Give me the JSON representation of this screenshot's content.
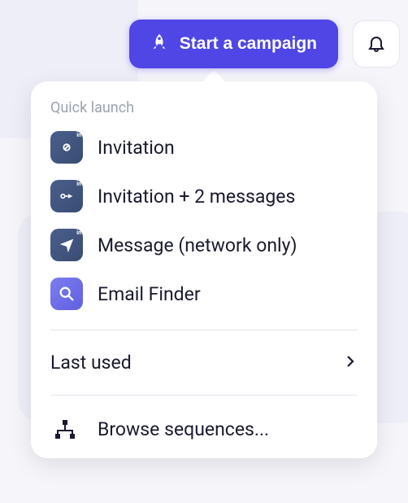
{
  "topbar": {
    "start_button_label": "Start a campaign"
  },
  "dropdown": {
    "section_label": "Quick launch",
    "items": [
      {
        "label": "Invitation"
      },
      {
        "label": "Invitation + 2 messages"
      },
      {
        "label": "Message (network only)"
      },
      {
        "label": "Email Finder"
      }
    ],
    "last_used_label": "Last used",
    "browse_label": "Browse sequences..."
  }
}
